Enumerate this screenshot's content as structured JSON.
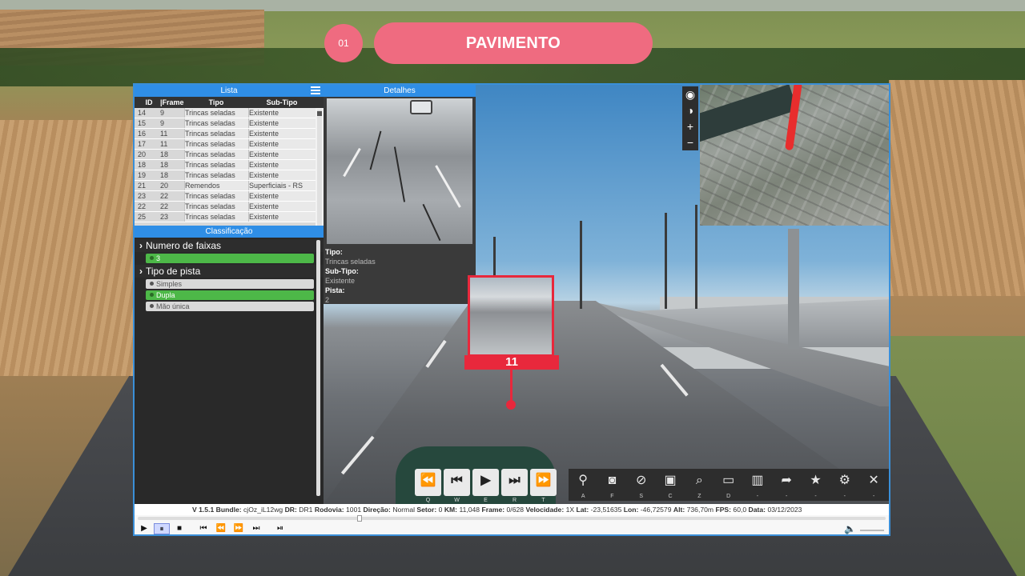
{
  "header": {
    "badge": "01",
    "title": "PAVIMENTO"
  },
  "lista": {
    "title": "Lista",
    "columns": [
      "ID",
      "|Frame|",
      "Tipo",
      "Sub-Tipo"
    ],
    "rows": [
      [
        "14",
        "9",
        "Trincas seladas",
        "Existente"
      ],
      [
        "15",
        "9",
        "Trincas seladas",
        "Existente"
      ],
      [
        "16",
        "11",
        "Trincas seladas",
        "Existente"
      ],
      [
        "17",
        "11",
        "Trincas seladas",
        "Existente"
      ],
      [
        "20",
        "18",
        "Trincas seladas",
        "Existente"
      ],
      [
        "18",
        "18",
        "Trincas seladas",
        "Existente"
      ],
      [
        "19",
        "18",
        "Trincas seladas",
        "Existente"
      ],
      [
        "21",
        "20",
        "Remendos",
        "Superficiais - RS"
      ],
      [
        "23",
        "22",
        "Trincas seladas",
        "Existente"
      ],
      [
        "22",
        "22",
        "Trincas seladas",
        "Existente"
      ],
      [
        "25",
        "23",
        "Trincas seladas",
        "Existente"
      ]
    ]
  },
  "classificacao": {
    "title": "Classificação",
    "groups": [
      {
        "title": "Numero de faixas",
        "options": [
          {
            "label": "3",
            "selected": true
          }
        ]
      },
      {
        "title": "Tipo de pista",
        "options": [
          {
            "label": "Simples",
            "selected": false
          },
          {
            "label": "Dupla",
            "selected": true
          },
          {
            "label": "Mão única",
            "selected": false
          }
        ]
      }
    ]
  },
  "detalhes": {
    "title": "Detalhes",
    "tipo_label": "Tipo:",
    "tipo": "Trincas seladas",
    "subtipo_label": "Sub-Tipo:",
    "subtipo": "Existente",
    "pista_label": "Pista:",
    "pista": "2"
  },
  "marker": {
    "label": "11"
  },
  "player": [
    {
      "icon": "rewind-icon",
      "glyph": "⏪",
      "key": "Q"
    },
    {
      "icon": "prev-frame-icon",
      "glyph": "⏮",
      "key": "W"
    },
    {
      "icon": "play-icon",
      "glyph": "▶",
      "key": "E"
    },
    {
      "icon": "next-frame-icon",
      "glyph": "⏭",
      "key": "R"
    },
    {
      "icon": "fast-forward-icon",
      "glyph": "⏩",
      "key": "T"
    }
  ],
  "tools": [
    {
      "icon": "pin-icon",
      "glyph": "⚲",
      "key": "A"
    },
    {
      "icon": "camera-icon",
      "glyph": "◙",
      "key": "F"
    },
    {
      "icon": "no-camera-icon",
      "glyph": "⊘",
      "key": "S"
    },
    {
      "icon": "camera-list-icon",
      "glyph": "▣",
      "key": "C"
    },
    {
      "icon": "zoom-icon",
      "glyph": "⌕",
      "key": "Z"
    },
    {
      "icon": "ruler-icon",
      "glyph": "▭",
      "key": "D"
    },
    {
      "icon": "map-icon",
      "glyph": "▥",
      "key": "-"
    },
    {
      "icon": "share-icon",
      "glyph": "➦",
      "key": "-"
    },
    {
      "icon": "star-icon",
      "glyph": "★",
      "key": "-"
    },
    {
      "icon": "gear-icon",
      "glyph": "⚙",
      "key": "-"
    },
    {
      "icon": "close-icon",
      "glyph": "✕",
      "key": "-"
    }
  ],
  "map_tools": [
    {
      "icon": "eye-icon",
      "glyph": "◉"
    },
    {
      "icon": "contrast-icon",
      "glyph": "◑"
    },
    {
      "icon": "zoom-in-icon",
      "glyph": "+"
    },
    {
      "icon": "zoom-out-icon",
      "glyph": "−"
    }
  ],
  "status": {
    "version": "V 1.5.1",
    "bundle_label": "Bundle:",
    "bundle": "cjOz_iL12wg",
    "dr_label": "DR:",
    "dr": "DR1",
    "rodovia_label": "Rodovia:",
    "rodovia": "1001",
    "direcao_label": "Direção:",
    "direcao": "Normal",
    "setor_label": "Setor:",
    "setor": "0",
    "km_label": "KM:",
    "km": "11,048",
    "frame_label": "Frame:",
    "frame": "0/628",
    "velocidade_label": "Velocidade:",
    "velocidade": "1X",
    "lat_label": "Lat:",
    "lat": "-23,51635",
    "lon_label": "Lon:",
    "lon": "-46,72579",
    "alt_label": "Alt:",
    "alt": "736,70m",
    "fps_label": "FPS:",
    "fps": "60,0",
    "data_label": "Data:",
    "data": "03/12/2023"
  },
  "media": [
    {
      "icon": "play-icon",
      "glyph": "▶"
    },
    {
      "icon": "pause-icon",
      "glyph": "⏸",
      "active": true
    },
    {
      "icon": "stop-icon",
      "glyph": "■"
    },
    {
      "icon": "skip-start-icon",
      "glyph": "⏮"
    },
    {
      "icon": "step-back-icon",
      "glyph": "⏪"
    },
    {
      "icon": "step-forward-icon",
      "glyph": "⏩"
    },
    {
      "icon": "skip-end-icon",
      "glyph": "⏭"
    },
    {
      "icon": "frame-step-icon",
      "glyph": "⏯"
    }
  ],
  "colors": {
    "accent": "#ef6b80",
    "panel_head": "#2f8ee6",
    "marker": "#e8283c",
    "selected": "#4db848"
  }
}
